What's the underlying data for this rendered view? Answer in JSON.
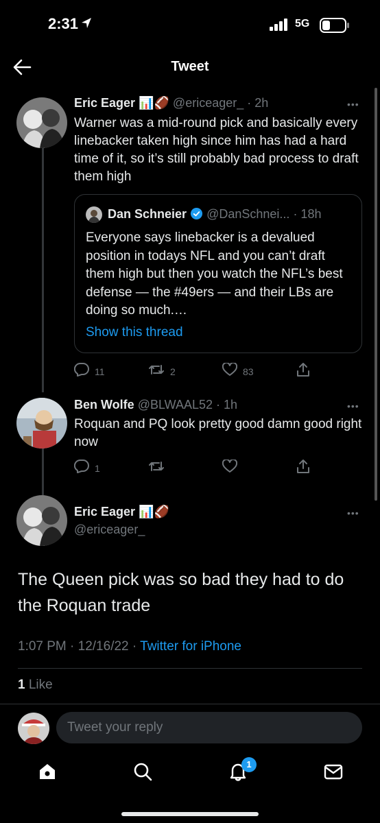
{
  "status_bar": {
    "time": "2:31",
    "network": "5G",
    "location_icon": "location-arrow-icon",
    "signal_icon": "signal-bars-icon",
    "battery_icon": "battery-icon"
  },
  "nav": {
    "title": "Tweet",
    "back_icon": "back-arrow-icon"
  },
  "tweet1": {
    "name": "Eric Eager",
    "emoji": "📊🏈",
    "handle": "@ericeager_",
    "time": "· 2h",
    "text": "Warner was a mid-round pick and basically every linebacker taken high since him has had a hard time of it, so it’s still probably bad process to draft them high",
    "quote": {
      "name": "Dan Schneier",
      "verified_icon": "verified-badge-icon",
      "handle": "@DanSchnei...",
      "time": "· 18h",
      "text": "Everyone says linebacker is a devalued position in todays NFL and you can’t draft them high but then you watch the NFL’s best defense — the #49ers — and their LBs are doing so much.…",
      "link": "Show this thread"
    },
    "replies": "11",
    "retweets": "2",
    "likes": "83"
  },
  "tweet2": {
    "name": "Ben Wolfe",
    "handle": "@BLWAAL52",
    "time": "· 1h",
    "text": "Roquan and PQ look pretty good damn good right now",
    "replies": "1"
  },
  "main_tweet": {
    "name": "Eric Eager",
    "emoji": "📊🏈",
    "handle": "@ericeager_",
    "text": "The Queen pick was so bad they had to do the Roquan trade",
    "timestamp": "1:07 PM · 12/16/22 · ",
    "source": "Twitter for iPhone",
    "like_count": "1",
    "like_label": " Like"
  },
  "reply": {
    "placeholder": "Tweet your reply"
  },
  "tabs": {
    "notifications_badge": "1"
  },
  "colors": {
    "accent": "#1d9bf0",
    "background": "#000000",
    "secondary_text": "#71767b",
    "border": "#2f3336"
  }
}
